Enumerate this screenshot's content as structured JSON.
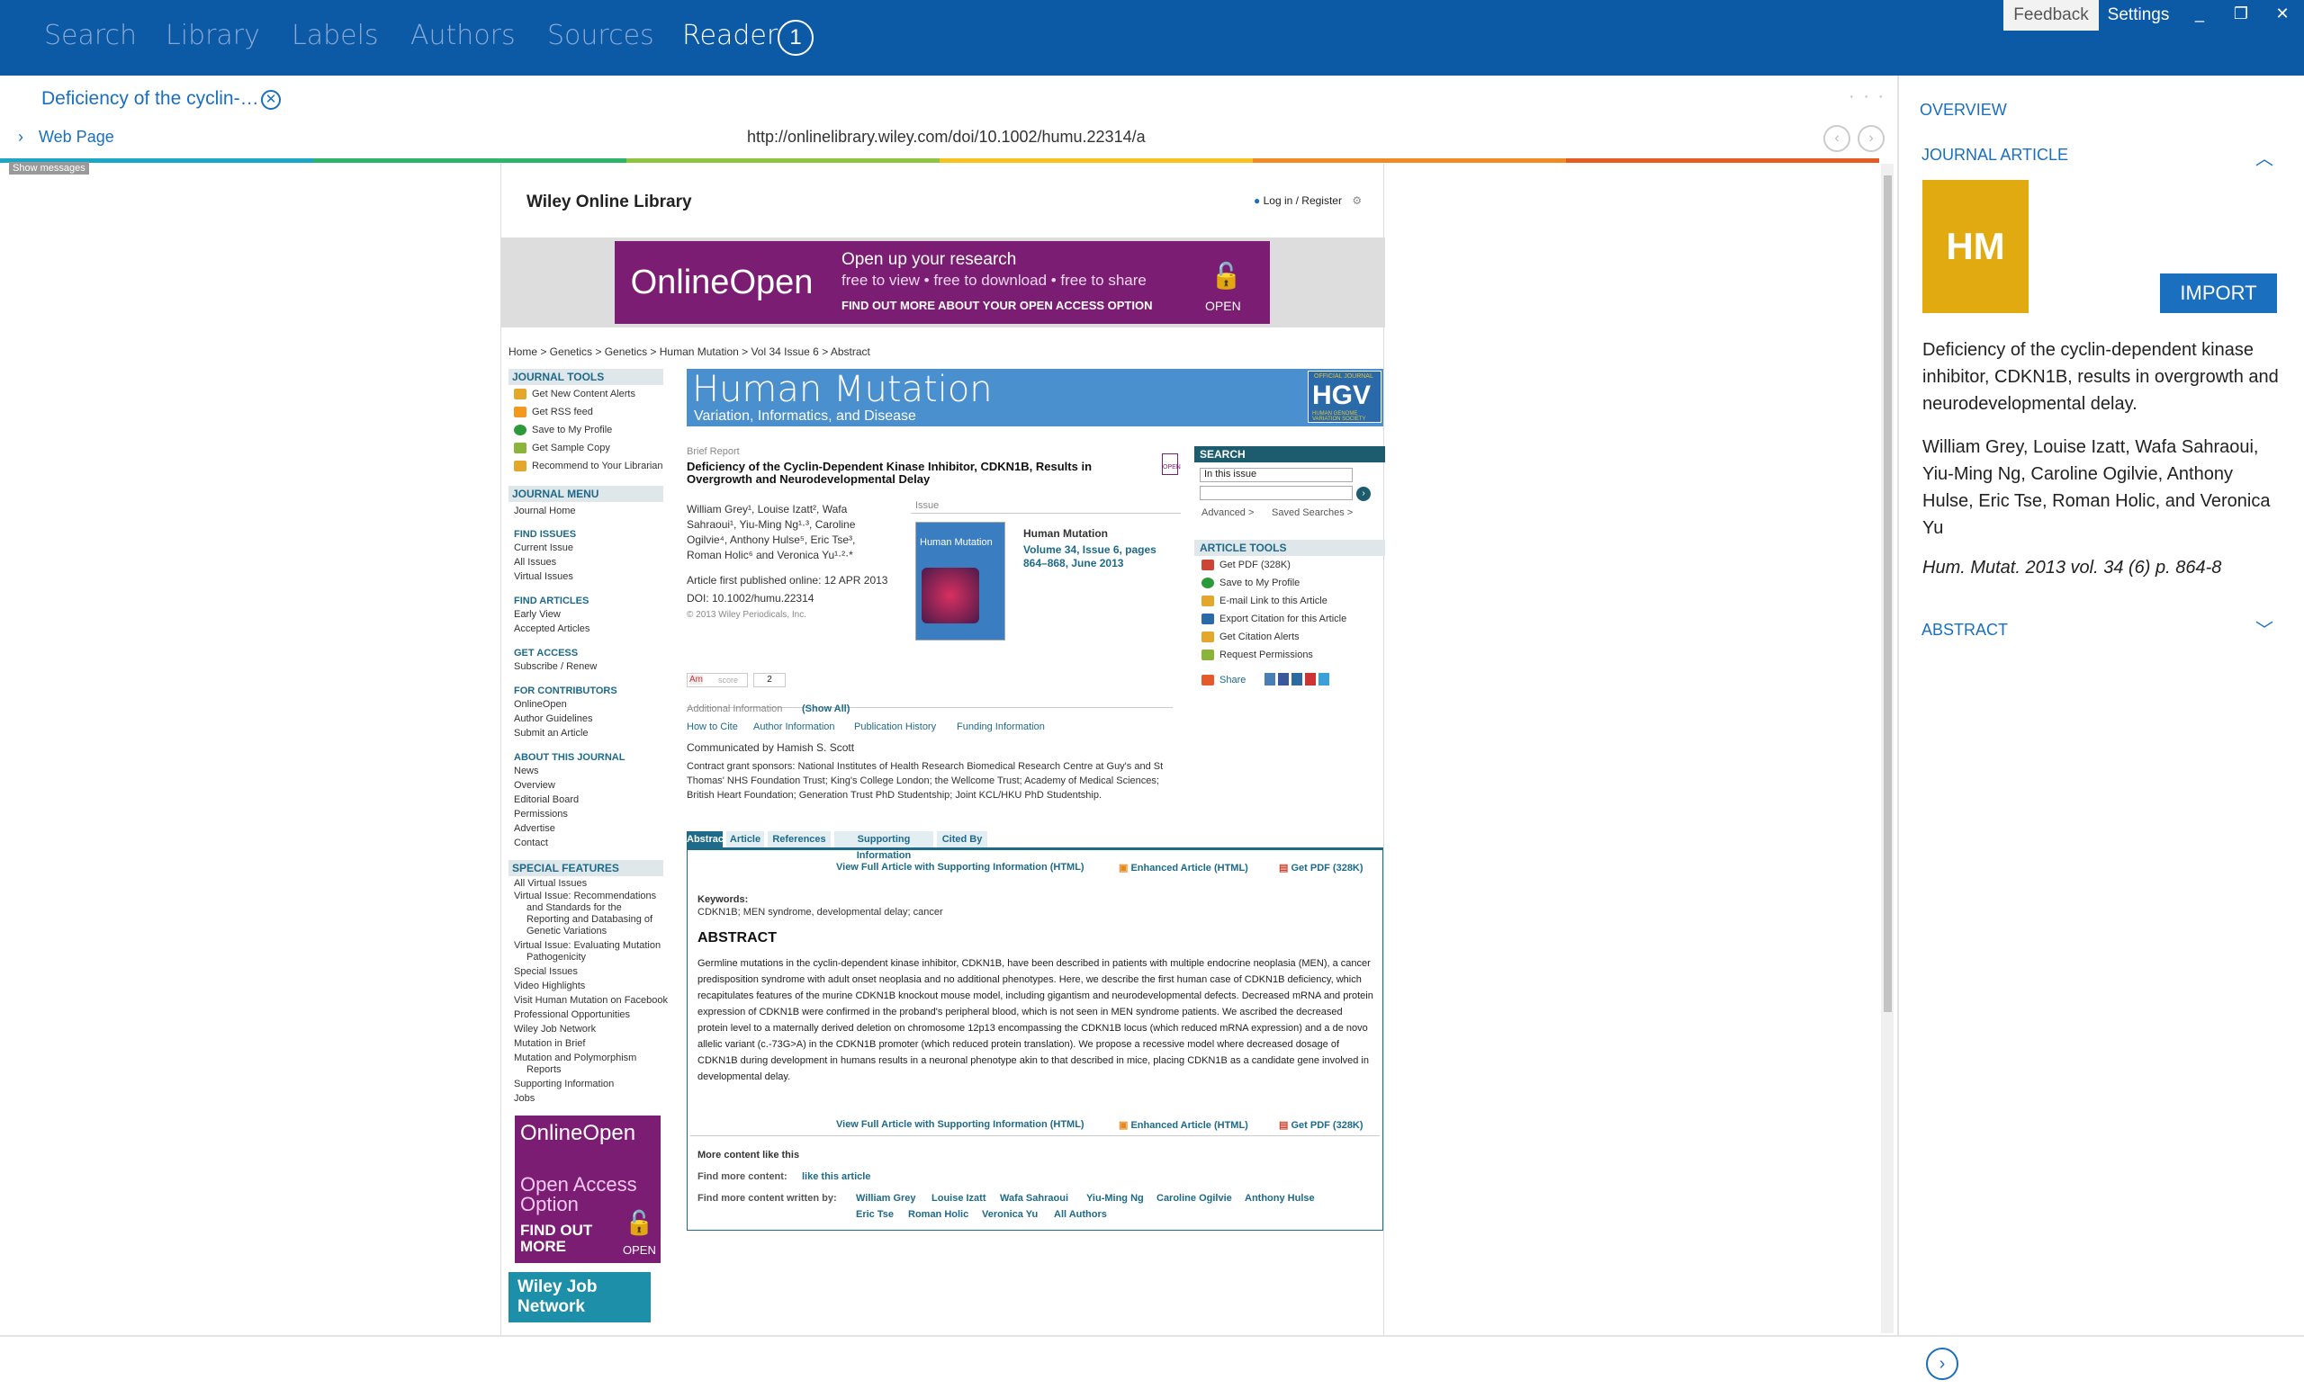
{
  "topnav": {
    "items": [
      "Search",
      "Library",
      "Labels",
      "Authors",
      "Sources",
      "Reader"
    ],
    "active": "Reader",
    "reader_count": "1",
    "feedback": "Feedback",
    "settings": "Settings",
    "minimize": "_",
    "restore": "❐",
    "close": "✕"
  },
  "reader": {
    "doc_tab": "Deficiency of the cyclin-…",
    "close_icon": "✕",
    "more_icon": "· · ·",
    "web_page_label": "Web Page",
    "url": "http://onlinelibrary.wiley.com/doi/10.1002/humu.22314/a",
    "show_messages": "Show messages",
    "colorbar": [
      "#1aa7c5",
      "#2ab56b",
      "#8ec33f",
      "#f6c31d",
      "#f08a22",
      "#e65b1f"
    ]
  },
  "web": {
    "site": "Wiley Online Library",
    "login": "Log in / Register",
    "banner": {
      "left": "OnlineOpen",
      "line1": "Open up your research",
      "line2": "free to view • free to download • free to share",
      "line3": "FIND OUT MORE ABOUT YOUR OPEN ACCESS OPTION",
      "open": "OPEN"
    },
    "breadcrumb": "Home >  Genetics >  Genetics >  Human Mutation >  Vol 34 Issue 6 >  Abstract",
    "journal_tools": {
      "heading": "JOURNAL TOOLS",
      "items": [
        "Get New Content Alerts",
        "Get RSS feed",
        "Save to My Profile",
        "Get Sample Copy",
        "Recommend to Your Librarian"
      ]
    },
    "journal_menu": {
      "heading": "JOURNAL MENU",
      "home": "Journal Home",
      "find_issues": "FIND ISSUES",
      "issues": [
        "Current Issue",
        "All Issues",
        "Virtual Issues"
      ],
      "find_articles": "FIND ARTICLES",
      "articles": [
        "Early View",
        "Accepted Articles"
      ],
      "get_access": "GET ACCESS",
      "access": [
        "Subscribe / Renew"
      ],
      "for_contributors": "FOR CONTRIBUTORS",
      "contributors": [
        "OnlineOpen",
        "Author Guidelines",
        "Submit an Article"
      ],
      "about": "ABOUT THIS JOURNAL",
      "about_items": [
        "News",
        "Overview",
        "Editorial Board",
        "Permissions",
        "Advertise",
        "Contact"
      ]
    },
    "special_features": {
      "heading": "SPECIAL FEATURES",
      "items": [
        "All Virtual Issues",
        "Virtual Issue: Recommendations",
        "and Standards for the",
        "Reporting and Databasing of",
        "Genetic Variations",
        "Virtual Issue: Evaluating Mutation",
        "Pathogenicity",
        "Special Issues",
        "Video Highlights",
        "Visit Human Mutation on Facebook",
        "Professional Opportunities",
        "Wiley Job Network",
        "Mutation in Brief",
        "Mutation and Polymorphism",
        "Reports",
        "Supporting Information",
        "Jobs"
      ]
    },
    "promo": {
      "online_open": "OnlineOpen",
      "oa1": "Open Access",
      "oa2": "Option",
      "find1": "FIND OUT",
      "find2": "MORE",
      "open": "OPEN",
      "wiley_job": "Wiley Job Network"
    },
    "journal": {
      "name": "Human Mutation",
      "subtitle": "Variation, Informatics, and Disease",
      "badge_small": "OFFICIAL JOURNAL",
      "badge": "HGV",
      "badge_sub": "HUMAN GENOME VARIATION SOCIETY"
    },
    "article": {
      "type": "Brief Report",
      "title": "Deficiency of the Cyclin-Dependent Kinase Inhibitor, CDKN1B, Results in Overgrowth and Neurodevelopmental Delay",
      "authors": "William Grey¹, Louise Izatt², Wafa Sahraoui¹, Yiu-Ming Ng¹·³, Caroline Ogilvie⁴, Anthony Hulse⁵, Eric Tse³, Roman Holic⁶ and Veronica Yu¹·²·*",
      "first_published": "Article first published online: 12 APR 2013",
      "doi": "DOI: 10.1002/humu.22314",
      "copyright": "© 2013 Wiley Periodicals, Inc.",
      "issue_label": "Issue",
      "issue_journal": "Human Mutation",
      "issue_link": "Volume 34, Issue 6, pages 864–868, June 2013",
      "cover_title": "Human Mutation",
      "altmetric_label": "Am",
      "score_label": "score",
      "score": "2",
      "additional_info": "Additional Information",
      "show_all": "(Show All)",
      "info_links": [
        "How to Cite",
        "Author Information",
        "Publication History",
        "Funding Information"
      ],
      "communicated": "Communicated by Hamish S. Scott",
      "grant": "Contract grant sponsors: National Institutes of Health Research Biomedical Research Centre at Guy's and St Thomas' NHS Foundation Trust; King's College London; the Wellcome Trust; Academy of Medical Sciences; British Heart Foundation; Generation Trust PhD Studentship; Joint KCL/HKU PhD Studentship."
    },
    "search": {
      "heading": "SEARCH",
      "scope": "In this issue",
      "advanced": "Advanced >",
      "saved": "Saved Searches >"
    },
    "article_tools": {
      "heading": "ARTICLE TOOLS",
      "items": [
        "Get PDF (328K)",
        "Save to My Profile",
        "E-mail Link to this Article",
        "Export Citation for this Article",
        "Get Citation Alerts",
        "Request Permissions"
      ],
      "share": "Share"
    },
    "tabs": [
      "Abstract",
      "Article",
      "References",
      "Supporting Information",
      "Cited By"
    ],
    "links": {
      "full": "View Full Article with Supporting Information (HTML)",
      "enhanced": "Enhanced Article (HTML)",
      "pdf": "Get PDF (328K)"
    },
    "keywords_label": "Keywords:",
    "keywords": "CDKN1B; MEN syndrome, developmental delay; cancer",
    "abstract_heading": "ABSTRACT",
    "abstract": "Germline mutations in the cyclin-dependent kinase inhibitor, CDKN1B, have been described in patients with multiple endocrine neoplasia (MEN), a cancer predisposition syndrome with adult onset neoplasia and no additional phenotypes. Here, we describe the first human case of CDKN1B deficiency, which recapitulates features of the murine CDKN1B knockout mouse model, including gigantism and neurodevelopmental defects. Decreased mRNA and protein expression of CDKN1B were confirmed in the proband's peripheral blood, which is not seen in MEN syndrome patients. We ascribed the decreased protein level to a maternally derived deletion on chromosome 12p13 encompassing the CDKN1B locus (which reduced mRNA expression) and a de novo allelic variant (c.-73G>A) in the CDKN1B promoter (which reduced protein translation). We propose a recessive model where decreased dosage of CDKN1B during development in humans results in a neuronal phenotype akin to that described in mice, placing CDKN1B as a candidate gene involved in developmental delay.",
    "more_content": "More content like this",
    "find_more": "Find more content:",
    "like_this": "like this article",
    "written_by": "Find more content written by:",
    "more_authors": [
      "William Grey",
      "Louise Izatt",
      "Wafa Sahraoui",
      "Yiu-Ming Ng",
      "Caroline Ogilvie",
      "Anthony Hulse",
      "Eric Tse",
      "Roman Holic",
      "Veronica Yu",
      "All Authors"
    ]
  },
  "panel": {
    "overview": "OVERVIEW",
    "journal_article": "JOURNAL ARTICLE",
    "initials": "HM",
    "initials_color": "#e0aa10",
    "import": "IMPORT",
    "title": "Deficiency of the cyclin-dependent kinase inhibitor, CDKN1B, results in overgrowth and neurodevelopmental delay.",
    "authors": "William Grey, Louise Izatt, Wafa Sahraoui, Yiu-Ming Ng, Caroline Ogilvie, Anthony Hulse, Eric Tse, Roman Holic, and Veronica Yu",
    "citation": "Hum. Mutat. 2013 vol. 34 (6) p. 864-8",
    "abstract": "ABSTRACT"
  }
}
